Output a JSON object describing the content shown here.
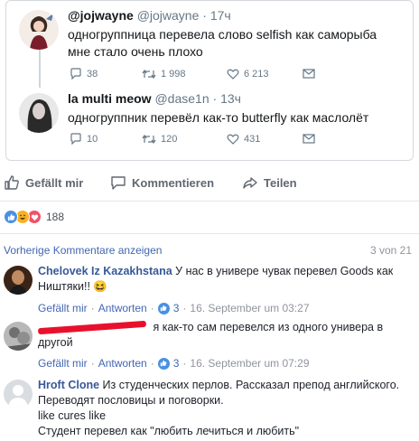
{
  "tweets": [
    {
      "name": "@jojwayne",
      "handle": "@jojwayne",
      "time": "17ч",
      "text": "одногруппница перевела слово selfish как саморыба мне стало очень плохо",
      "replies": "38",
      "retweets": "1 998",
      "likes": "6 213"
    },
    {
      "name": "la multi meow",
      "handle": "@dase1n",
      "time": "13ч",
      "text": "одногруппник перевёл как-то butterfly как маслолёт",
      "replies": "10",
      "retweets": "120",
      "likes": "431"
    }
  ],
  "fb_actions": {
    "like": "Gefällt mir",
    "comment": "Kommentieren",
    "share": "Teilen"
  },
  "reactions": {
    "count": "188"
  },
  "previous": {
    "link": "Vorherige Kommentare anzeigen",
    "count": "3 von 21"
  },
  "comments": [
    {
      "author": "Chelovek Iz Kazakhstana",
      "text": "У нас в универе чувак перевел Goods как Ништяки!!",
      "emoji": "😆",
      "like": "Gefällt mir",
      "reply": "Antworten",
      "likes": "3",
      "date": "16. September um 03:27"
    },
    {
      "author": "",
      "text": "я как-то сам перевелся из одного универа в другой",
      "like": "Gefällt mir",
      "reply": "Antworten",
      "likes": "3",
      "date": "16. September um 07:29"
    },
    {
      "author": "Hroft Clone",
      "text": "Из студенческих перлов. Рассказал препод английского. Переводят пословицы и поговорки.",
      "text2": "like cures like",
      "text3": "Студент перевел как \"любить лечиться и любить\""
    }
  ],
  "colors": {
    "fb_link": "#4267b2",
    "author": "#385898",
    "like_blue": "#4a90e2",
    "love_red": "#f25268",
    "haha_yellow": "#f7b125"
  }
}
